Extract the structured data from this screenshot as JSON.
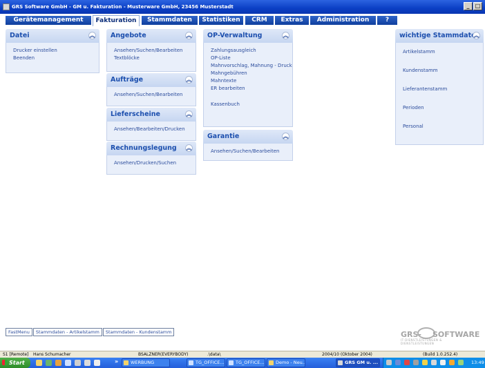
{
  "window": {
    "title": "GRS Software GmbH - GM u. Fakturation - Musterware GmbH, 23456 Musterstadt",
    "buttons": {
      "minimize": "_",
      "maximize": "□",
      "close": "x"
    }
  },
  "menu": {
    "tabs": [
      {
        "label": "Gerätemanagement"
      },
      {
        "label": "Fakturation"
      },
      {
        "label": "Stammdaten"
      },
      {
        "label": "Statistiken"
      },
      {
        "label": "CRM"
      },
      {
        "label": "Extras"
      },
      {
        "label": "Administration"
      },
      {
        "label": "?"
      }
    ],
    "active_tab": "Fakturation"
  },
  "panels": {
    "datei": {
      "title": "Datei",
      "items": [
        "Drucker einstellen",
        "Beenden"
      ]
    },
    "angebote": {
      "title": "Angebote",
      "items": [
        "Ansehen/Suchen/Bearbeiten",
        "Textblöcke"
      ]
    },
    "auftraege": {
      "title": "Aufträge",
      "items": [
        "Ansehen/Suchen/Bearbeiten"
      ]
    },
    "lieferscheine": {
      "title": "Lieferscheine",
      "items": [
        "Ansehen/Bearbeiten/Drucken"
      ]
    },
    "rechnungslegung": {
      "title": "Rechnungslegung",
      "items": [
        "Ansehen/Drucken/Suchen"
      ]
    },
    "op_verwaltung": {
      "title": "OP-Verwaltung",
      "items": [
        "Zahlungsausgleich",
        "OP-Liste",
        "Mahnvorschlag, Mahnung - Druck",
        "Mahngebühren",
        "Mahntexte",
        "ER bearbeiten",
        "Kassenbuch"
      ]
    },
    "garantie": {
      "title": "Garantie",
      "items": [
        "Ansehen/Suchen/Bearbeiten"
      ]
    },
    "stammdaten": {
      "title": "wichtige Stammdaten",
      "items": [
        "Artikelstamm",
        "Kundenstamm",
        "Lieferantenstamm",
        "Perioden",
        "Personal"
      ]
    }
  },
  "bottom_tabs": [
    "FastMenu",
    "Stammdaten - Artikelstamm",
    "Stammdaten - Kundenstamm"
  ],
  "logo": {
    "text_left": "GRS-",
    "text_right": "SOFTWARE",
    "subtitle": "IT-DIENSTLEISTUNGEN & DIENSTLEISTUNGEN"
  },
  "status": {
    "session": "S1 [Remote]",
    "user": "Hans Schumacher",
    "printer": "BSALZNER(EVERYBODY)",
    "path": ".\\data\\",
    "period": "2004/10 (Oktober 2004)",
    "build": "(Build 1.0.252.4)"
  },
  "taskbar": {
    "start_label": "Start",
    "overflow": "»",
    "tasks": [
      {
        "label": "WERBUNG",
        "active": false
      },
      {
        "label": "TG_OFFICE...",
        "active": false
      },
      {
        "label": "TG_OFFICE...",
        "active": false
      },
      {
        "label": "Demo - Neu...",
        "active": false
      },
      {
        "label": "GRS GM u. ...",
        "active": true
      }
    ],
    "clock": "13:49"
  }
}
